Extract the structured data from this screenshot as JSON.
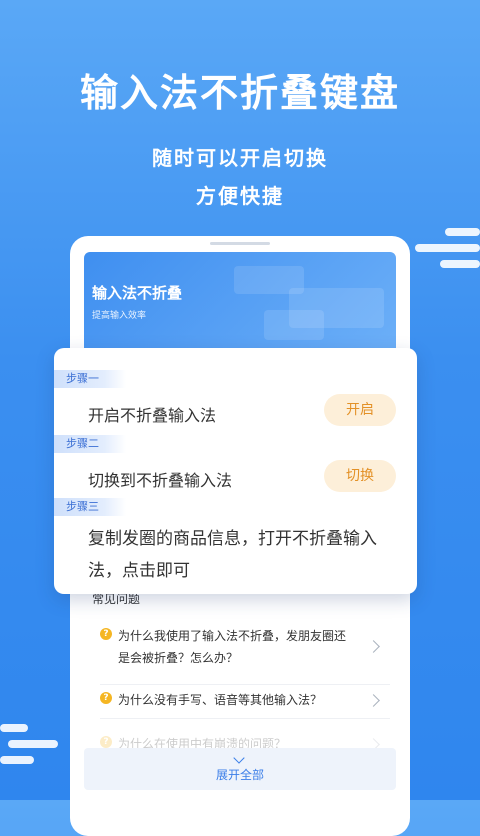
{
  "hero": {
    "headline": "输入法不折叠键盘",
    "sub1": "随时可以开启切换",
    "sub2": "方便快捷"
  },
  "banner": {
    "title": "输入法不折叠",
    "subtitle": "提高输入效率"
  },
  "steps": [
    {
      "tag": "步骤一",
      "text": "开启不折叠输入法",
      "button": "开启"
    },
    {
      "tag": "步骤二",
      "text": "切换到不折叠输入法",
      "button": "切换"
    },
    {
      "tag": "步骤三",
      "text": "复制发圈的商品信息，打开不折叠输入法，点击即可"
    }
  ],
  "faq": {
    "title": "常见问题",
    "items": [
      "为什么我使用了输入法不折叠，发朋友圈还是会被折叠？怎么办？",
      "为什么没有手写、语音等其他输入法？",
      "为什么在使用中有崩溃的问题？"
    ],
    "expand": "展开全部"
  },
  "colors": {
    "bg_top": "#5aa8f6",
    "bg_bottom": "#2f86ee",
    "accent": "#3b7ee8",
    "pill_bg": "#fdefd9",
    "pill_text": "#e39127"
  }
}
